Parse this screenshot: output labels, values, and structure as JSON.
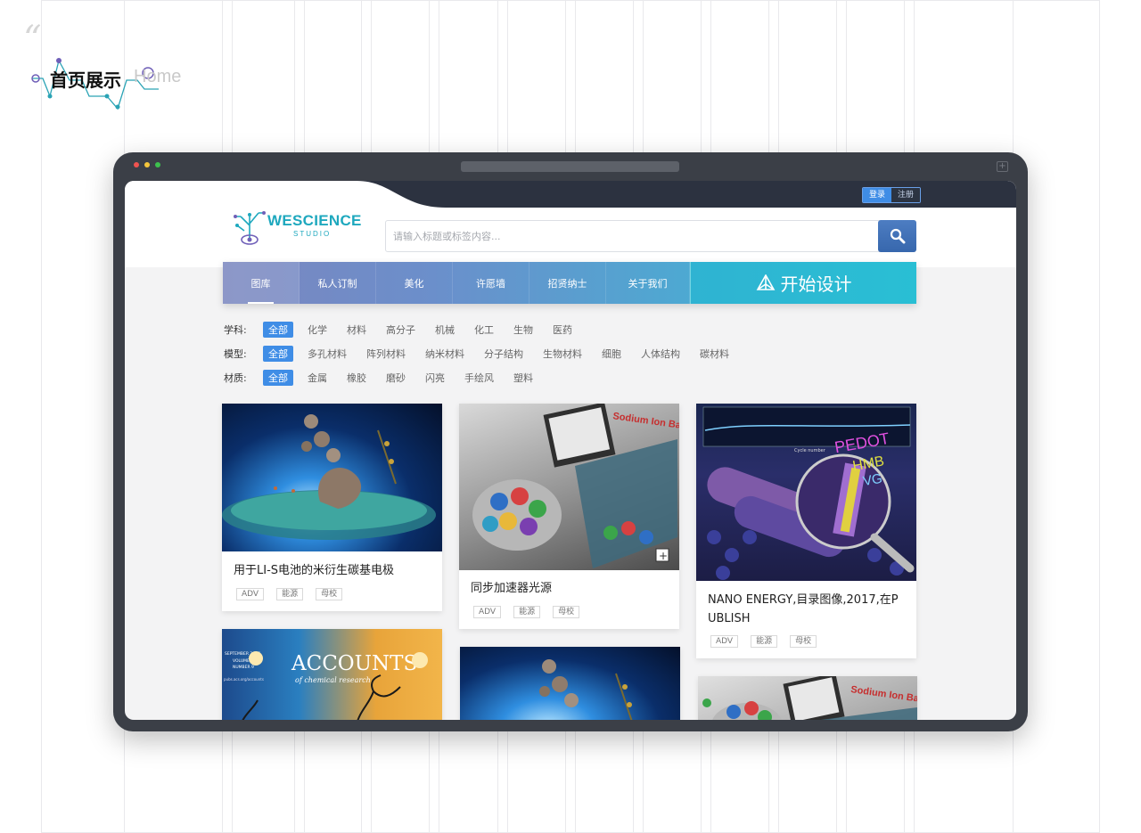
{
  "heading": {
    "quote_mark": "“",
    "title_cn": "首页展示",
    "title_en": "Home"
  },
  "header": {
    "login": "登录",
    "register": "注册",
    "logo_title": "WESCIENCE",
    "logo_sub": "STUDIO",
    "search_placeholder": "请输入标题或标签内容..."
  },
  "nav": {
    "items": [
      "图库",
      "私人订制",
      "美化",
      "许愿墙",
      "招贤纳士",
      "关于我们"
    ],
    "active_index": 0,
    "design_label": "开始设计"
  },
  "filters": [
    {
      "label": "学科:",
      "options": [
        "全部",
        "化学",
        "材料",
        "高分子",
        "机械",
        "化工",
        "生物",
        "医药"
      ]
    },
    {
      "label": "模型:",
      "options": [
        "全部",
        "多孔材料",
        "阵列材料",
        "纳米材料",
        "分子结构",
        "生物材料",
        "细胞",
        "人体结构",
        "碳材料"
      ]
    },
    {
      "label": "材质:",
      "options": [
        "全部",
        "金属",
        "橡胶",
        "磨砂",
        "闪亮",
        "手绘风",
        "塑料"
      ]
    }
  ],
  "cards": [
    {
      "title": "用于LI-S电池的米衍生碳基电极",
      "tags": [
        "ADV",
        "能源",
        "母校"
      ]
    },
    {
      "title": "同步加速器光源",
      "tags": [
        "ADV",
        "能源",
        "母校"
      ],
      "image_text": "Sodium Ion Batteries"
    },
    {
      "title_lines": [
        "NANO ENERGY,目录图像,2017,在P",
        "UBLISH"
      ],
      "tags": [
        "ADV",
        "能源",
        "母校"
      ],
      "image_text": [
        "PEDOT",
        "HMB",
        "VG",
        "Cycle number"
      ]
    },
    {
      "image_text": [
        "ACCOUNTS",
        "of chemical research",
        "SEPTEMBER 2017",
        "VOLUME 50",
        "NUMBER 9",
        "pubs.acs.org/accounts"
      ]
    },
    {
      "image_text": ""
    },
    {
      "image_text": "Sodium Ion Batteries"
    }
  ],
  "colors": {
    "accent": "#3f8de6",
    "brand": "#1ea8be",
    "nav_design": "#2fb3d2"
  }
}
